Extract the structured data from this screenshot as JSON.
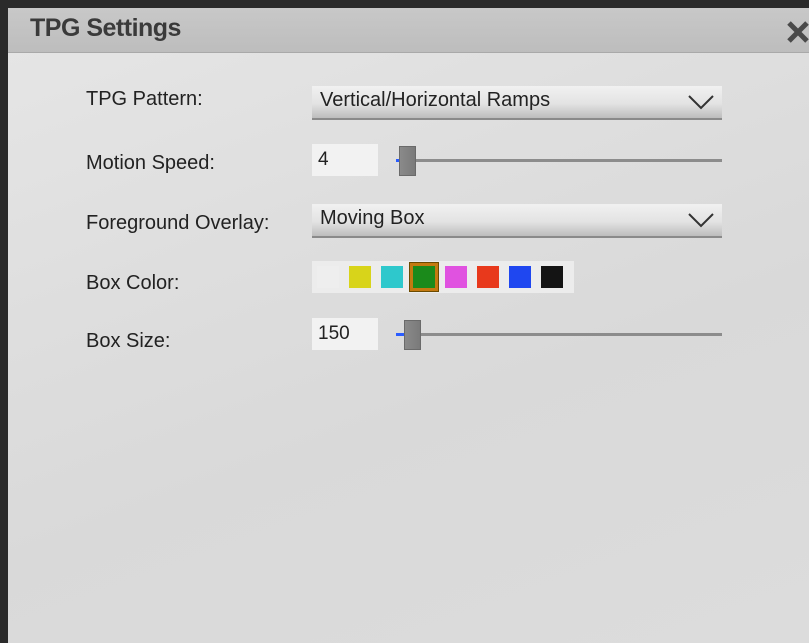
{
  "window": {
    "title": "TPG Settings"
  },
  "rows": {
    "pattern": {
      "label": "TPG Pattern:",
      "value": "Vertical/Horizontal Ramps"
    },
    "speed": {
      "label": "Motion Speed:",
      "value": "4",
      "slider_fraction": 0.02
    },
    "overlay": {
      "label": "Foreground Overlay:",
      "value": "Moving Box"
    },
    "box_color": {
      "label": "Box Color:",
      "selected": "green",
      "colors": [
        {
          "name": "white",
          "hex": "#eeeeee"
        },
        {
          "name": "yellow",
          "hex": "#d8d41a"
        },
        {
          "name": "cyan",
          "hex": "#2ec8cc"
        },
        {
          "name": "green",
          "hex": "#1b8a1b"
        },
        {
          "name": "magenta",
          "hex": "#e052e0"
        },
        {
          "name": "red",
          "hex": "#e8391c"
        },
        {
          "name": "blue",
          "hex": "#1f47f0"
        },
        {
          "name": "black",
          "hex": "#141414"
        }
      ]
    },
    "box_size": {
      "label": "Box Size:",
      "value": "150",
      "slider_fraction": 0.03
    }
  },
  "icons": {
    "close": "close-icon",
    "dropdown": "chevron-down-icon"
  }
}
